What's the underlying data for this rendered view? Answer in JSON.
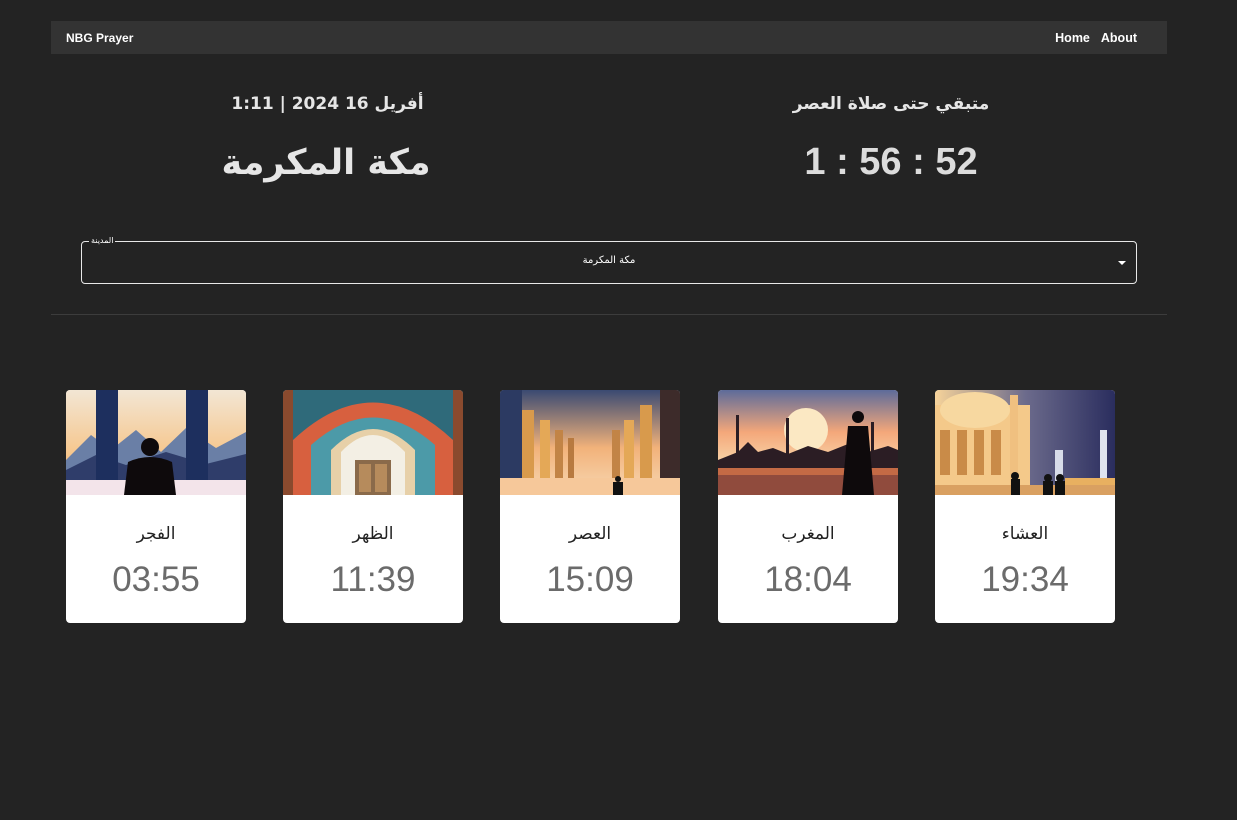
{
  "navbar": {
    "brand": "NBG Prayer",
    "links": [
      {
        "label": "Home"
      },
      {
        "label": "About"
      }
    ]
  },
  "header": {
    "datetime": "أفريل 16 2024 | 1:11",
    "city": "مكة المكرمة",
    "remaining_label": "متبقي حتى صلاة العصر",
    "countdown": "1 : 56 : 52"
  },
  "city_select": {
    "label": "المدينة",
    "value": "مكة المكرمة"
  },
  "prayers": [
    {
      "name": "العشاء",
      "time": "19:34",
      "image": "mosque-night-image"
    },
    {
      "name": "المغرب",
      "time": "18:04",
      "image": "sunset-silhouette-image"
    },
    {
      "name": "العصر",
      "time": "15:09",
      "image": "colonnade-image"
    },
    {
      "name": "الظهر",
      "time": "11:39",
      "image": "mosque-arch-image"
    },
    {
      "name": "الفجر",
      "time": "03:55",
      "image": "dawn-mountains-image"
    }
  ],
  "colors": {
    "background": "#232323",
    "navbar": "#333333",
    "card": "#ffffff",
    "time_text": "#6b6b6b"
  }
}
